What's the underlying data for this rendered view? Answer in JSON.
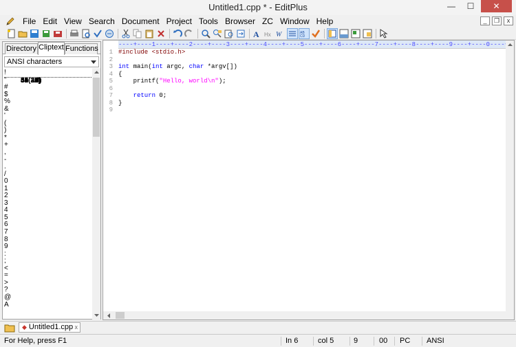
{
  "window": {
    "title": "Untitled1.cpp * - EditPlus",
    "minimize": "—",
    "maximize": "☐",
    "close": "✕"
  },
  "menu": {
    "items": [
      {
        "label": "File"
      },
      {
        "label": "Edit"
      },
      {
        "label": "View"
      },
      {
        "label": "Search"
      },
      {
        "label": "Document"
      },
      {
        "label": "Project"
      },
      {
        "label": "Tools"
      },
      {
        "label": "Browser"
      },
      {
        "label": "ZC"
      },
      {
        "label": "Window"
      },
      {
        "label": "Help"
      }
    ],
    "mdi": {
      "min": "_",
      "restore": "❐",
      "close": "x"
    }
  },
  "sidebar": {
    "tabs": [
      {
        "label": "Directory"
      },
      {
        "label": "Cliptext"
      },
      {
        "label": "Functions"
      }
    ],
    "dropdown_value": "ANSI characters",
    "chars": [
      {
        "code": "33(21)",
        "ch": "!"
      },
      {
        "code": "34(22)",
        "ch": "\""
      },
      {
        "code": "35(23)",
        "ch": "#"
      },
      {
        "code": "36(24)",
        "ch": "$"
      },
      {
        "code": "37(25)",
        "ch": "%"
      },
      {
        "code": "38(26)",
        "ch": "&"
      },
      {
        "code": "39(27)",
        "ch": "'"
      },
      {
        "code": "40(28)",
        "ch": "("
      },
      {
        "code": "41(29)",
        "ch": ")"
      },
      {
        "code": "42(2A)",
        "ch": "*"
      },
      {
        "code": "43(2B)",
        "ch": "+"
      },
      {
        "code": "44(2C)",
        "ch": ","
      },
      {
        "code": "45(2D)",
        "ch": "-"
      },
      {
        "code": "46(2E)",
        "ch": "."
      },
      {
        "code": "47(2F)",
        "ch": "/"
      },
      {
        "code": "48(30)",
        "ch": "0"
      },
      {
        "code": "49(31)",
        "ch": "1"
      },
      {
        "code": "50(32)",
        "ch": "2"
      },
      {
        "code": "51(33)",
        "ch": "3"
      },
      {
        "code": "52(34)",
        "ch": "4"
      },
      {
        "code": "53(35)",
        "ch": "5"
      },
      {
        "code": "54(36)",
        "ch": "6"
      },
      {
        "code": "55(37)",
        "ch": "7"
      },
      {
        "code": "56(38)",
        "ch": "8"
      },
      {
        "code": "57(39)",
        "ch": "9"
      },
      {
        "code": "58(3A)",
        "ch": ":"
      },
      {
        "code": "59(3B)",
        "ch": ";"
      },
      {
        "code": "60(3C)",
        "ch": "<"
      },
      {
        "code": "61(3D)",
        "ch": "="
      },
      {
        "code": "62(3E)",
        "ch": ">"
      },
      {
        "code": "63(3F)",
        "ch": "?"
      },
      {
        "code": "64(40)",
        "ch": "@"
      },
      {
        "code": "65(41)",
        "ch": "A"
      }
    ]
  },
  "editor": {
    "ruler": "----+----1----+----2----+----3----+----4----+----5----+----6----+----7----+----8----+----9----+----0----+",
    "line_numbers": [
      "1",
      "2",
      "3",
      "4",
      "5",
      "6",
      "7",
      "8",
      "9"
    ],
    "lines": [
      [
        {
          "t": "#include <stdio.h>",
          "c": "#800000"
        }
      ],
      [],
      [
        {
          "t": "int",
          "c": "#0000ff"
        },
        {
          "t": " main(",
          "c": "#000000"
        },
        {
          "t": "int",
          "c": "#0000ff"
        },
        {
          "t": " argc, ",
          "c": "#000000"
        },
        {
          "t": "char",
          "c": "#0000ff"
        },
        {
          "t": " *argv[])",
          "c": "#000000"
        }
      ],
      [
        {
          "t": "{",
          "c": "#000000"
        }
      ],
      [
        {
          "t": "    printf(",
          "c": "#000000"
        },
        {
          "t": "\"Hello, world\\n\"",
          "c": "#ff00ff"
        },
        {
          "t": ");",
          "c": "#000000"
        }
      ],
      [],
      [
        {
          "t": "    ",
          "c": "#000000"
        },
        {
          "t": "return",
          "c": "#0000ff"
        },
        {
          "t": " 0;",
          "c": "#000000"
        }
      ],
      [
        {
          "t": "}",
          "c": "#000000"
        }
      ],
      []
    ]
  },
  "doctab": {
    "label": "Untitled1.cpp",
    "close": "x"
  },
  "status": {
    "help": "For Help, press F1",
    "line": "In 6",
    "col": "col 5",
    "count": "9",
    "hex": "00",
    "mode": "PC",
    "encoding": "ANSI"
  }
}
